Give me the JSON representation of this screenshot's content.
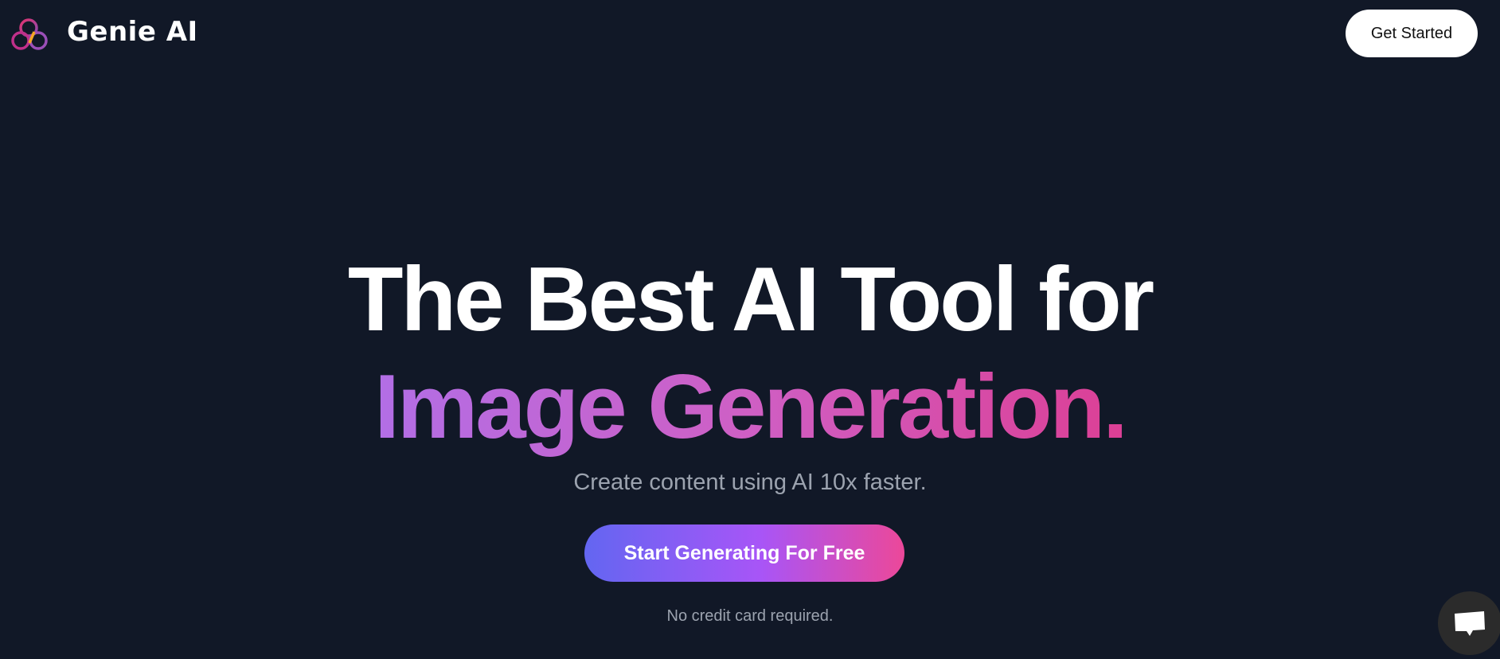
{
  "header": {
    "brand": "Genie AI",
    "get_started_label": "Get Started",
    "logo_icon": "genie-ai-logo-icon"
  },
  "hero": {
    "headline_line1": "The Best AI Tool for",
    "headline_line2": "Image Generation.",
    "subtitle": "Create content using AI 10x faster.",
    "cta_label": "Start Generating For Free",
    "note": "No credit card required."
  },
  "colors": {
    "background": "#111827",
    "gradient_start": "#6366f1",
    "gradient_end": "#ec4899"
  },
  "chat_widget": {
    "icon": "chat-bubble-icon"
  }
}
